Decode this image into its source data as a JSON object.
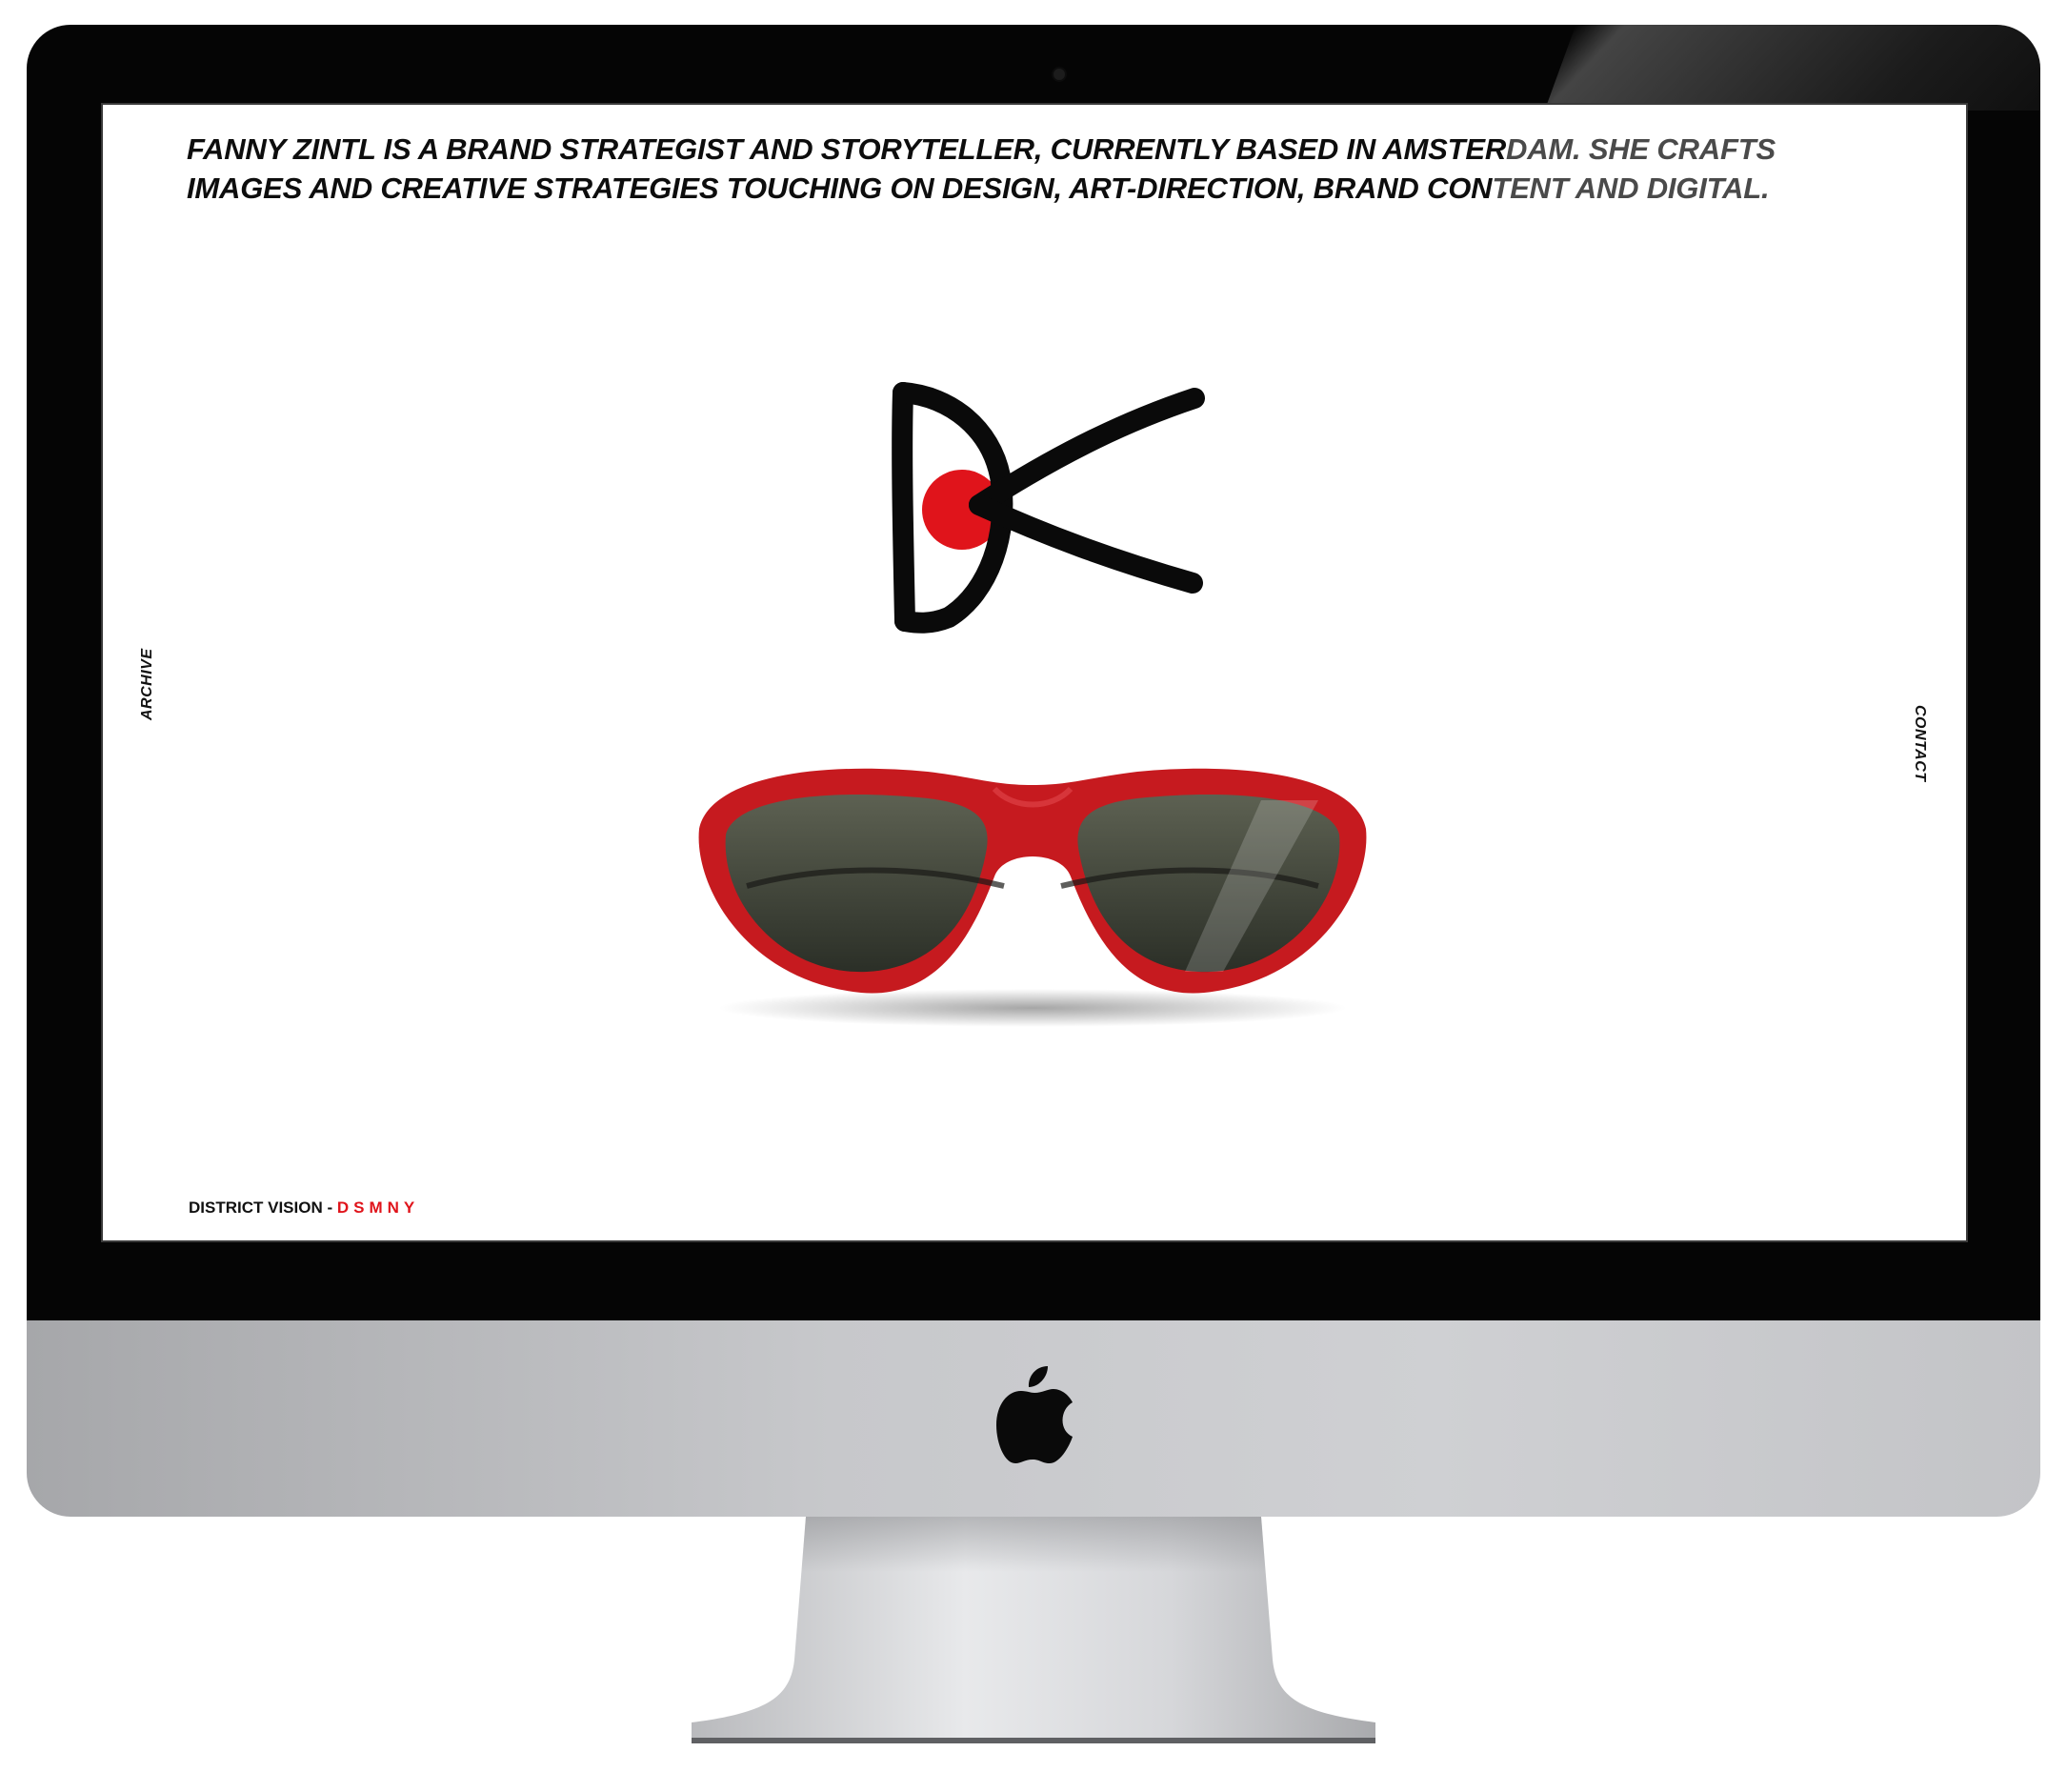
{
  "headline": {
    "line1_dark": "FANNY ZINTL IS A BRAND STRATEGIST AND STORYTELLER, CURRENTLY BASED IN AMSTER",
    "line1_faded": "DAM. SHE CRAFTS",
    "line2_dark": "IMAGES AND CREATIVE STRATEGIES TOUCHING ON DESIGN, ART-DIRECTION, BRAND CON",
    "line2_faded": "TENT AND DIGITAL."
  },
  "nav": {
    "archive_label": "ARCHIVE",
    "contact_label": "CONTACT"
  },
  "project": {
    "client": "DISTRICT VISION",
    "separator": " - ",
    "link_label": "DSMNY"
  },
  "icons": {
    "logo": "district-vision-logo-icon",
    "product": "sunglasses-image",
    "device_brand": "apple-logo-icon"
  },
  "colors": {
    "accent": "#e0141b",
    "text": "#0d0d0d",
    "bezel": "#050505",
    "chin": "#c7c8cb"
  }
}
